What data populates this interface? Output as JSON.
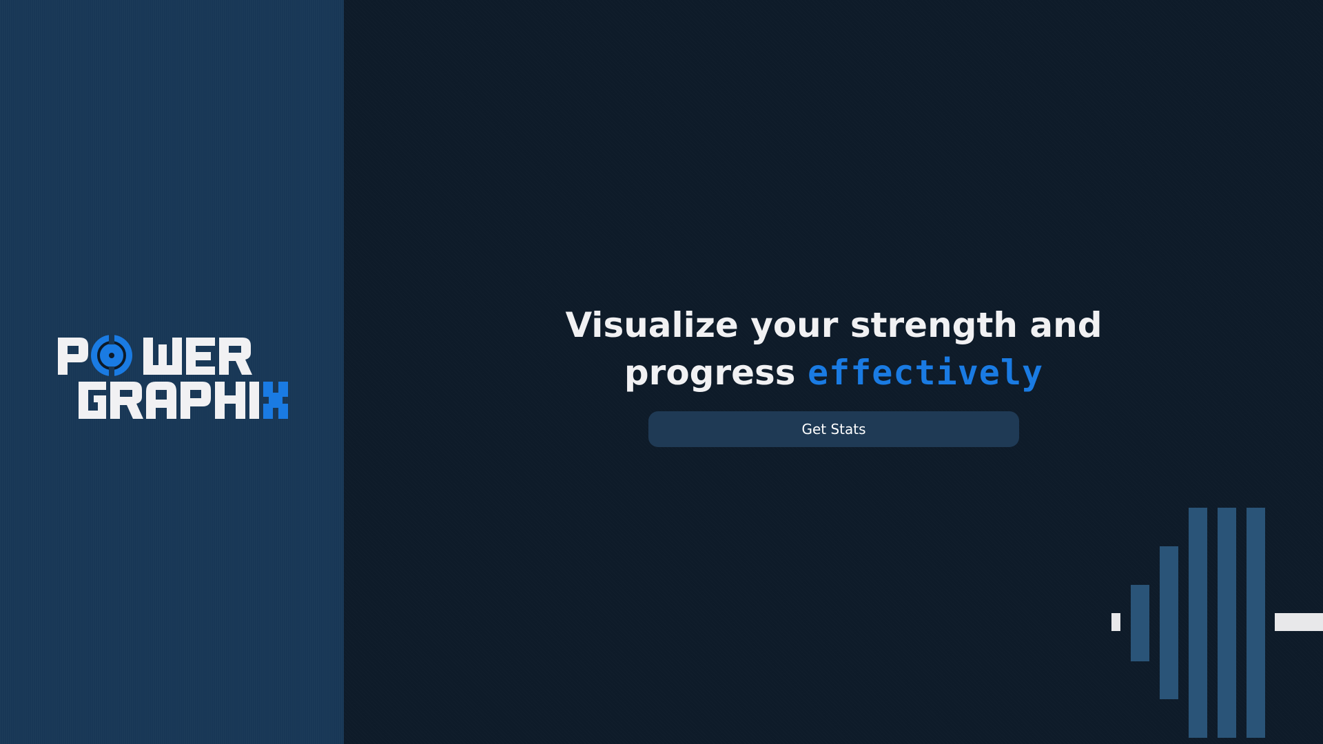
{
  "brand": {
    "line1": "POWER",
    "line2": "GRAPHIX",
    "accent_color": "#1a7be3",
    "text_color": "#f1f1f3"
  },
  "hero": {
    "headline_part1": "Visualize your strength and progress",
    "headline_accent": "effectively"
  },
  "cta": {
    "label": "Get Stats"
  },
  "colors": {
    "sidebar_bg": "#183756",
    "main_bg": "#0e1b29",
    "button_bg": "#1f3a55",
    "barbell_plate": "#2a5478",
    "barbell_bar": "#e8e8ea"
  },
  "decorations": {
    "barbell_icon": "barbell-icon",
    "logo_plate_icon": "weight-plate-icon"
  }
}
